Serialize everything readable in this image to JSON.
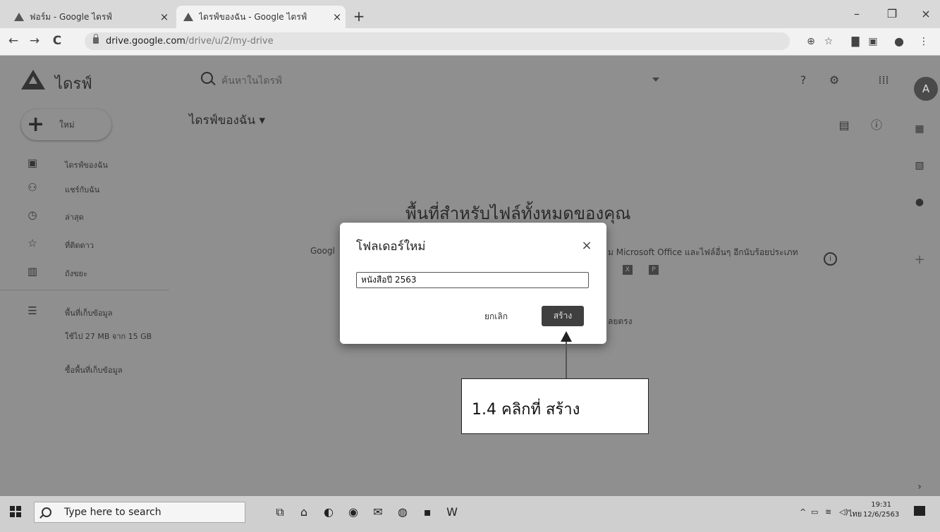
{
  "browser": {
    "tabs": [
      {
        "title": "ฟอร์ม - Google ไดรฟ์",
        "close": "×"
      },
      {
        "title": "ไดรฟ์ของฉัน - Google ไดรฟ์",
        "close": "×"
      }
    ],
    "new_tab": "+",
    "window_controls": {
      "minimize": "–",
      "maximize": "❐",
      "close": "×"
    },
    "nav": {
      "back": "←",
      "forward": "→",
      "reload": "C"
    },
    "url_host": "drive.google.com",
    "url_path": "/drive/u/2/my-drive"
  },
  "drive": {
    "app_title": "ไดรฟ์",
    "search_placeholder": "ค้นหาในไดรฟ์",
    "new_button_label": "ใหม่",
    "my_drive_heading": "ไดรฟ์ของฉัน ▾",
    "avatar_letter": "A",
    "sidebar": {
      "items": [
        {
          "label": "ไดรฟ์ของฉัน",
          "icon": "drive-icon"
        },
        {
          "label": "แชร์กับฉัน",
          "icon": "people-icon"
        },
        {
          "label": "ล่าสุด",
          "icon": "clock-icon"
        },
        {
          "label": "ที่ติดดาว",
          "icon": "star-icon"
        },
        {
          "label": "ถังขยะ",
          "icon": "trash-icon"
        }
      ],
      "storage_label": "พื้นที่เก็บข้อมูล",
      "storage_usage": "ใช้ไป 27 MB จาก 15 GB",
      "buy_storage": "ซื้อพื้นที่เก็บข้อมูล"
    },
    "empty_state": {
      "heading": "พื้นที่สำหรับไฟล์ทั้งหมดของคุณ",
      "subtext_left": "Googl",
      "subtext_right": "ม Microsoft Office และไฟล์อื่นๆ อีกนับร้อยประเภท",
      "subtext_lower": "ลยตรง"
    }
  },
  "dialog": {
    "title": "โฟลเดอร์ใหม่",
    "close": "×",
    "input_value": "หนังสือปี 2563",
    "cancel_label": "ยกเลิก",
    "create_label": "สร้าง"
  },
  "annotation": {
    "callout_text": "1.4 คลิกที่ สร้าง"
  },
  "taskbar": {
    "search_placeholder": "Type here to search",
    "language": "ไทย",
    "time": "19:31",
    "date": "12/6/2563"
  }
}
